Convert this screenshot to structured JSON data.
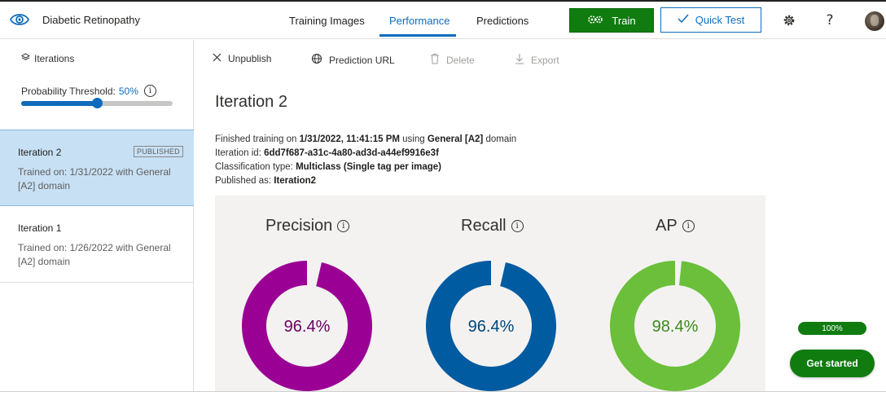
{
  "header": {
    "app_title": "Diabetic Retinopathy",
    "tabs": [
      {
        "label": "Training Images",
        "active": false
      },
      {
        "label": "Performance",
        "active": true
      },
      {
        "label": "Predictions",
        "active": false
      }
    ],
    "train_label": "Train",
    "quick_test_label": "Quick Test",
    "icons": [
      "eye-icon",
      "gears-icon",
      "checkmark-icon",
      "settings-icon",
      "help-icon",
      "avatar"
    ]
  },
  "sidebar": {
    "iterations_label": "Iterations",
    "threshold_label": "Probability Threshold:",
    "threshold_value": "50%",
    "threshold_fraction": 0.5,
    "items": [
      {
        "name": "Iteration 2",
        "badge": "PUBLISHED",
        "desc": "Trained on: 1/31/2022 with General [A2] domain",
        "selected": true
      },
      {
        "name": "Iteration 1",
        "badge": "",
        "desc": "Trained on: 1/26/2022 with General [A2] domain",
        "selected": false
      }
    ]
  },
  "toolbar": {
    "unpublish": "Unpublish",
    "prediction_url": "Prediction URL",
    "delete": "Delete",
    "export": "Export"
  },
  "main": {
    "title": "Iteration 2",
    "finished_prefix": "Finished training on ",
    "finished_date": "1/31/2022, 11:41:15 PM",
    "finished_mid": " using ",
    "finished_domain": "General [A2]",
    "finished_suffix": " domain",
    "iteration_id_label": "Iteration id: ",
    "iteration_id": "6dd7f687-a31c-4a80-ad3d-a44ef9916e3f",
    "classification_label": "Classification type: ",
    "classification_value": "Multiclass (Single tag per image)",
    "published_label": "Published as: ",
    "published_value": "Iteration2"
  },
  "metrics": [
    {
      "name": "Precision",
      "value": "96.4%",
      "fraction": 0.964,
      "color": "#9b0095",
      "text_color": "#6a005f"
    },
    {
      "name": "Recall",
      "value": "96.4%",
      "fraction": 0.964,
      "color": "#005ba1",
      "text_color": "#004578"
    },
    {
      "name": "AP",
      "value": "98.4%",
      "fraction": 0.984,
      "color": "#6bbf3a",
      "text_color": "#3e8a1e"
    }
  ],
  "onboarding": {
    "progress_label": "100%",
    "progress_fraction": 1.0,
    "get_started_label": "Get started"
  },
  "colors": {
    "accent": "#0f6cbd",
    "train_green": "#107c10",
    "selected_bg": "#c7e0f4",
    "panel_bg": "#f3f2f1"
  }
}
